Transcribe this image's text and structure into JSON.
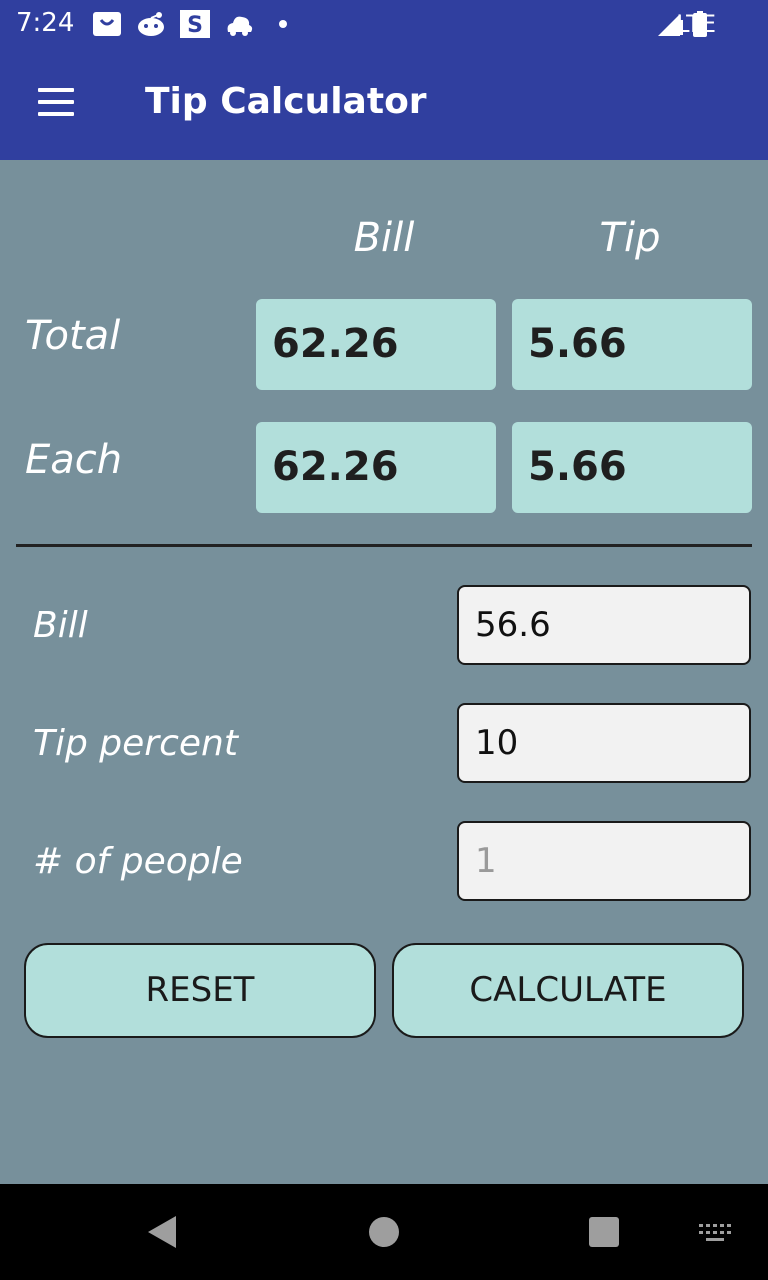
{
  "status_bar": {
    "time": "7:24",
    "network": "LTE",
    "icons": [
      "shopping-bag-icon",
      "reddit-icon",
      "s-app-icon",
      "cloud-car-icon",
      "dot-icon",
      "signal-icon",
      "battery-icon"
    ]
  },
  "app_bar": {
    "title": "Tip Calculator",
    "menu_icon": "hamburger-menu-icon"
  },
  "results": {
    "columns": [
      "Bill",
      "Tip"
    ],
    "rows": [
      {
        "label": "Total",
        "bill": "62.26",
        "tip": "5.66"
      },
      {
        "label": "Each",
        "bill": "62.26",
        "tip": "5.66"
      }
    ]
  },
  "inputs": {
    "bill": {
      "label": "Bill",
      "value": "56.6"
    },
    "tip_percent": {
      "label": "Tip percent",
      "value": "10"
    },
    "people": {
      "label": "# of people",
      "placeholder": "1"
    }
  },
  "buttons": {
    "reset": "RESET",
    "calculate": "CALCULATE"
  },
  "colors": {
    "primary": "#303f9f",
    "background": "#77909b",
    "accent_box": "#b2dfdb",
    "field_bg": "#f2f2f2"
  },
  "nav_bar": {
    "icons": [
      "back-icon",
      "home-icon",
      "recents-icon",
      "keyboard-icon"
    ]
  }
}
